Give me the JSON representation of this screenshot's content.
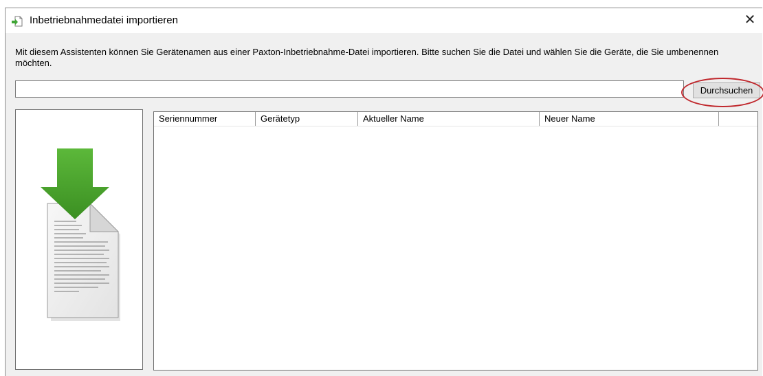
{
  "window": {
    "title": "Inbetriebnahmedatei importieren",
    "close_symbol": "✕",
    "icon": "import-file-icon"
  },
  "main": {
    "description": "Mit diesem Assistenten können Sie Gerätenamen aus einer Paxton-Inbetriebnahme-Datei importieren. Bitte suchen Sie die Datei und wählen Sie die Geräte, die Sie umbenennen möchten.",
    "file_path": "",
    "browse_label": "Durchsuchen",
    "illustration": "download-document-icon"
  },
  "device_list": {
    "columns": [
      "Seriennummer",
      "Gerätetyp",
      "Aktueller Name",
      "Neuer Name",
      ""
    ],
    "rows": []
  },
  "colors": {
    "highlight": "#c0282d",
    "arrow_green": "#4aa32c"
  }
}
